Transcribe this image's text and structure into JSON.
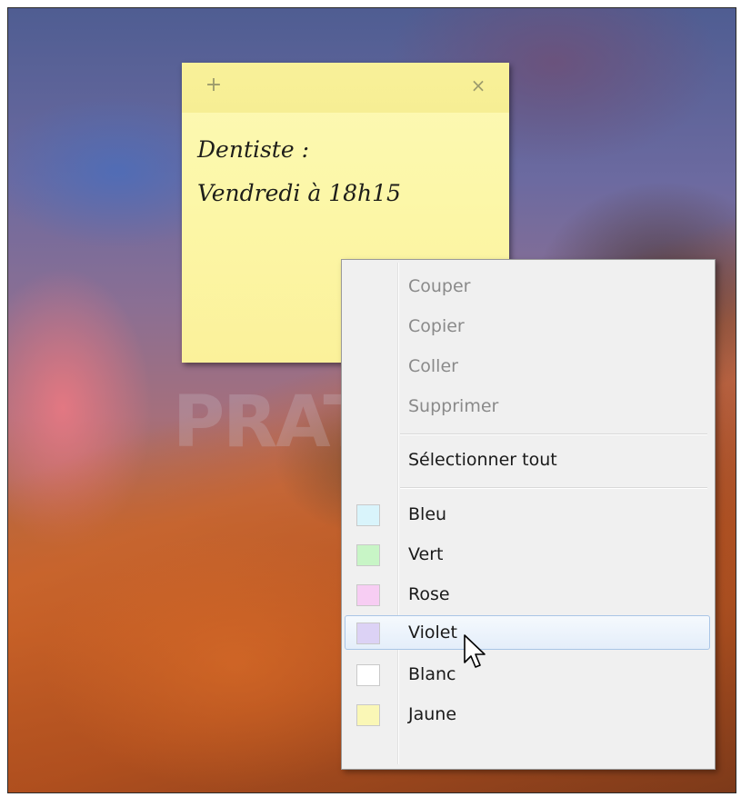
{
  "note": {
    "add_symbol": "+",
    "close_symbol": "×",
    "lines": [
      "Dentiste :",
      "Vendredi à 18h15"
    ],
    "color": "#fcf7a8"
  },
  "watermark": "PRATICES",
  "context_menu": {
    "edit_items": [
      {
        "label": "Couper",
        "enabled": false
      },
      {
        "label": "Copier",
        "enabled": false
      },
      {
        "label": "Coller",
        "enabled": false
      },
      {
        "label": "Supprimer",
        "enabled": false
      }
    ],
    "select_all": "Sélectionner tout",
    "colors": [
      {
        "label": "Bleu",
        "swatch": "#d9f4fb"
      },
      {
        "label": "Vert",
        "swatch": "#c8f5c6"
      },
      {
        "label": "Rose",
        "swatch": "#f7cdf3"
      },
      {
        "label": "Violet",
        "swatch": "#dcd2f5",
        "hovered": true
      },
      {
        "label": "Blanc",
        "swatch": "#ffffff"
      },
      {
        "label": "Jaune",
        "swatch": "#faf7b6"
      }
    ]
  }
}
